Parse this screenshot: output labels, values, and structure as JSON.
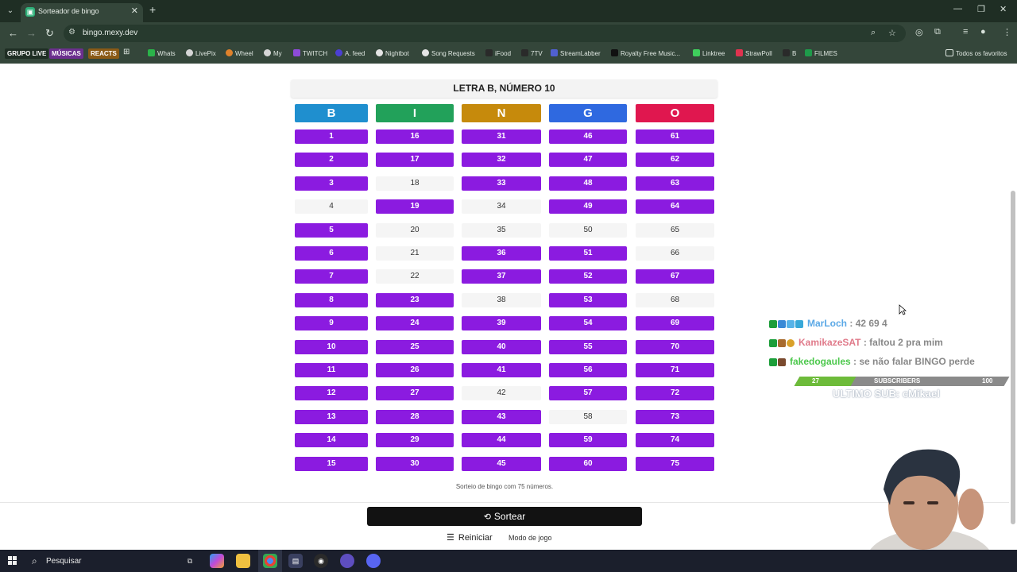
{
  "browser": {
    "tab_title": "Sorteador de bingo",
    "url": "bingo.mexy.dev",
    "bookmarks": [
      {
        "label": "GRUPO LIVE",
        "style": "badge",
        "color": "#1f2e24"
      },
      {
        "label": "MÚSICAS",
        "style": "badge",
        "color": "#6b2f8e"
      },
      {
        "label": "REACTS",
        "style": "badge",
        "color": "#8a5a16"
      },
      {
        "label": "Whats",
        "color": "#2bb34a"
      },
      {
        "label": "LivePix",
        "color": "#d6d6d6"
      },
      {
        "label": "Wheel",
        "color": "#e0822b"
      },
      {
        "label": "My",
        "color": "#d6d6d6"
      },
      {
        "label": "TWITCH",
        "color": "#8d4bd8"
      },
      {
        "label": "A. feed",
        "color": "#4b3fd4"
      },
      {
        "label": "Nightbot",
        "color": "#e5e5e5"
      },
      {
        "label": "Song Requests",
        "color": "#e5e5e5"
      },
      {
        "label": "iFood",
        "color": "#2a2a2a"
      },
      {
        "label": "7TV",
        "color": "#2a2a2a"
      },
      {
        "label": "StreamLabber",
        "color": "#5060d0"
      },
      {
        "label": "Royalty Free Music...",
        "color": "#111111"
      },
      {
        "label": "Linktree",
        "color": "#3fcf5c"
      },
      {
        "label": "StrawPoll",
        "color": "#e0334f"
      },
      {
        "label": "B",
        "color": "#2a2a2a"
      },
      {
        "label": "FILMES",
        "color": "#1e9b4a"
      }
    ],
    "favorites_label": "Todos os favoritos"
  },
  "bingo": {
    "header": "LETRA B, NÚMERO 10",
    "columns": [
      {
        "letter": "B",
        "color": "#1f8fcf",
        "numbers": [
          1,
          2,
          3,
          4,
          5,
          6,
          7,
          8,
          9,
          10,
          11,
          12,
          13,
          14,
          15
        ],
        "drawn": [
          1,
          2,
          3,
          5,
          6,
          7,
          8,
          9,
          10,
          11,
          12,
          13,
          14,
          15
        ]
      },
      {
        "letter": "I",
        "color": "#22a15a",
        "numbers": [
          16,
          17,
          18,
          19,
          20,
          21,
          22,
          23,
          24,
          25,
          26,
          27,
          28,
          29,
          30
        ],
        "drawn": [
          16,
          17,
          19,
          23,
          24,
          25,
          26,
          27,
          28,
          29,
          30
        ]
      },
      {
        "letter": "N",
        "color": "#c68a0c",
        "numbers": [
          31,
          32,
          33,
          34,
          35,
          36,
          37,
          38,
          39,
          40,
          41,
          42,
          43,
          44,
          45
        ],
        "drawn": [
          31,
          32,
          33,
          36,
          37,
          39,
          40,
          41,
          43,
          44,
          45
        ]
      },
      {
        "letter": "G",
        "color": "#2f69e0",
        "numbers": [
          46,
          47,
          48,
          49,
          50,
          51,
          52,
          53,
          54,
          55,
          56,
          57,
          58,
          59,
          60
        ],
        "drawn": [
          46,
          47,
          48,
          49,
          51,
          52,
          53,
          54,
          55,
          56,
          57,
          59,
          60
        ]
      },
      {
        "letter": "O",
        "color": "#e0174f",
        "numbers": [
          61,
          62,
          63,
          64,
          65,
          66,
          67,
          68,
          69,
          70,
          71,
          72,
          73,
          74,
          75
        ],
        "drawn": [
          61,
          62,
          63,
          64,
          67,
          69,
          70,
          71,
          72,
          73,
          74,
          75
        ]
      }
    ],
    "footnote": "Sorteio de bingo com 75 números.",
    "draw_button": "Sortear",
    "reset_button": "Reiniciar",
    "mode_select": "Modo de jogo"
  },
  "overlay": {
    "chat": [
      {
        "user": "MarLoch",
        "message": ": 42 69 4",
        "user_color": "#5aa8e6"
      },
      {
        "user": "KamikazeSAT",
        "message": ": faltou 2 pra mim",
        "user_color": "#e07a8a"
      },
      {
        "user": "fakedogaules",
        "message": ": se não falar BINGO perde",
        "user_color": "#4cc84c"
      }
    ],
    "subs": {
      "current": "27",
      "label": "SUBSCRIBERS",
      "goal": "100",
      "progress": 0.27
    },
    "last_sub": "ULTIMO SUB: cMikael"
  },
  "taskbar": {
    "search_placeholder": "Pesquisar"
  }
}
